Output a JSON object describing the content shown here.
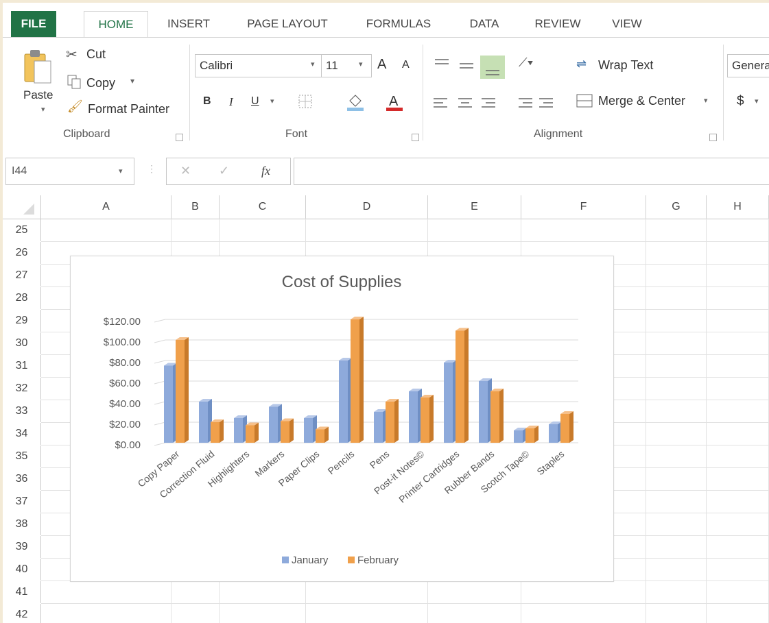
{
  "tabs": [
    "FILE",
    "HOME",
    "INSERT",
    "PAGE LAYOUT",
    "FORMULAS",
    "DATA",
    "REVIEW",
    "VIEW"
  ],
  "clipboard": {
    "paste": "Paste",
    "cut": "Cut",
    "copy": "Copy",
    "format_painter": "Format Painter",
    "group": "Clipboard"
  },
  "font": {
    "name": "Calibri",
    "size": "11",
    "bold": "B",
    "italic": "I",
    "underline": "U",
    "grow": "A",
    "shrink": "A",
    "color": "A",
    "group": "Font"
  },
  "alignment": {
    "wrap_text": "Wrap Text",
    "merge_center": "Merge & Center",
    "group": "Alignment"
  },
  "number": {
    "format": "Genera",
    "currency": "$"
  },
  "formula_bar": {
    "name_box": "I44",
    "fx": "fx",
    "value": ""
  },
  "columns": [
    "A",
    "B",
    "C",
    "D",
    "E",
    "F",
    "G",
    "H"
  ],
  "rows": [
    "25",
    "26",
    "27",
    "28",
    "29",
    "30",
    "31",
    "32",
    "33",
    "34",
    "35",
    "36",
    "37",
    "38",
    "39",
    "40",
    "41",
    "42"
  ],
  "colors": {
    "excel_green": "#217346",
    "january": "#8eaadb",
    "february": "#f0a04b"
  },
  "chart_data": {
    "type": "bar",
    "title": "Cost of Supplies",
    "categories": [
      "Copy Paper",
      "Correction Fluid",
      "Highlighters",
      "Markers",
      "Paper Clips",
      "Pencils",
      "Pens",
      "Post-it Notes©",
      "Printer Cartridges",
      "Rubber Bands",
      "Scotch Tape©",
      "Staples"
    ],
    "series": [
      {
        "name": "January",
        "values": [
          75,
          40,
          24,
          35,
          24,
          80,
          30,
          50,
          78,
          60,
          12,
          18
        ]
      },
      {
        "name": "February",
        "values": [
          100,
          20,
          17,
          21,
          13,
          120,
          40,
          44,
          109,
          50,
          14,
          28
        ]
      }
    ],
    "y_ticks": [
      "$0.00",
      "$20.00",
      "$40.00",
      "$60.00",
      "$80.00",
      "$100.00",
      "$120.00"
    ],
    "ylim": [
      0,
      120
    ],
    "grid": true,
    "legend": "bottom",
    "style": "3d-clustered-column"
  }
}
